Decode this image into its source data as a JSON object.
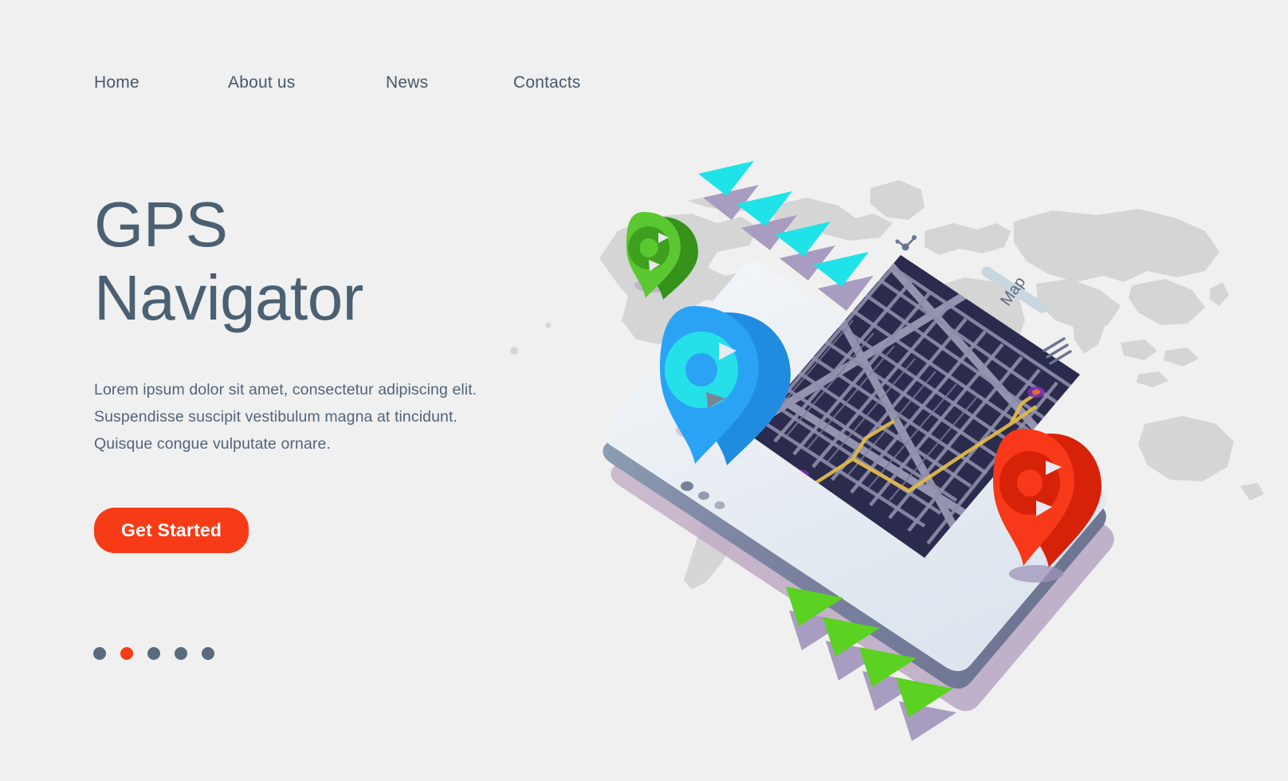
{
  "page": {
    "background_color": "#f0f0f0",
    "text_color": "#4b6072",
    "accent_color": "#f73b16"
  },
  "nav": {
    "items": [
      {
        "label": "Home"
      },
      {
        "label": "About us"
      },
      {
        "label": "News"
      },
      {
        "label": "Contacts"
      }
    ]
  },
  "hero": {
    "title": "GPS\nNavigator",
    "paragraph_lines": [
      "Lorem ipsum dolor sit amet, consectetur adipiscing elit.",
      "Suspendisse suscipit vestibulum magna at tincidunt.",
      "Quisque congue vulputate ornare."
    ],
    "cta_label": "Get Started"
  },
  "carousel": {
    "total": 5,
    "active_index": 1,
    "dot_color": "#5a6b7d",
    "active_dot_color": "#f73b16"
  },
  "illustration": {
    "name": "isometric-gps-phone-world-map",
    "phone": {
      "screen_label": "Map",
      "screen_color": "#2b2b4d",
      "street_color": "#9a9ab5",
      "route_color": "#e0b94a",
      "body_color": "#edf1f5",
      "edge_color": "#737b99",
      "shadow_color": "#bfa9bf"
    },
    "world_map_color": "#d3d3d3",
    "pins": [
      {
        "name": "green-pin",
        "color": "#5bc831",
        "color_dark": "#3fa01f"
      },
      {
        "name": "blue-pin",
        "color": "#2aa3f5",
        "color_dark": "#1f8ce0"
      },
      {
        "name": "red-pin",
        "color": "#f7391a",
        "color_dark": "#d62208"
      }
    ],
    "arrows": [
      {
        "name": "cyan-arrow-group",
        "color": "#1fe3e8",
        "count": 4,
        "shadow_color": "#a89dc0"
      },
      {
        "name": "green-arrow-group",
        "color": "#5bd122",
        "count": 4,
        "shadow_color": "#a89dc0"
      }
    ]
  }
}
